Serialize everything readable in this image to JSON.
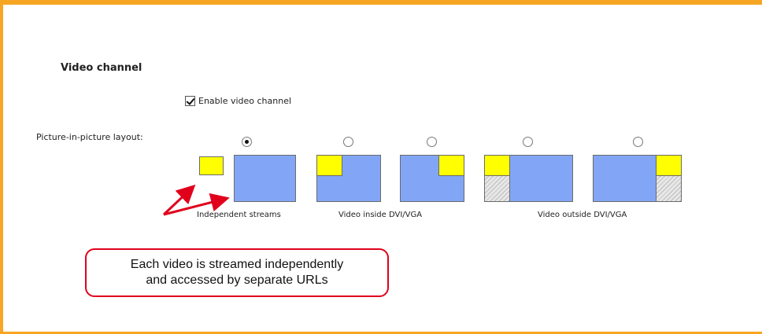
{
  "section": {
    "title": "Video channel"
  },
  "enable": {
    "label": "Enable video channel",
    "checked": true
  },
  "pip": {
    "label": "Picture-in-picture layout:",
    "selected_index": 0,
    "options": [
      {
        "id": "independent"
      },
      {
        "id": "inside-top-left"
      },
      {
        "id": "inside-top-right"
      },
      {
        "id": "outside-left"
      },
      {
        "id": "outside-right"
      }
    ],
    "groups": [
      {
        "caption": "Independent streams"
      },
      {
        "caption": "Video inside DVI/VGA"
      },
      {
        "caption": "Video outside DVI/VGA"
      }
    ]
  },
  "callout": {
    "line1": "Each video is streamed independently",
    "line2": "and accessed by separate URLs"
  },
  "colors": {
    "frame": "#f6a623",
    "primary": "#82a6f5",
    "secondary": "#ffff00",
    "annotation": "#e0001b"
  }
}
